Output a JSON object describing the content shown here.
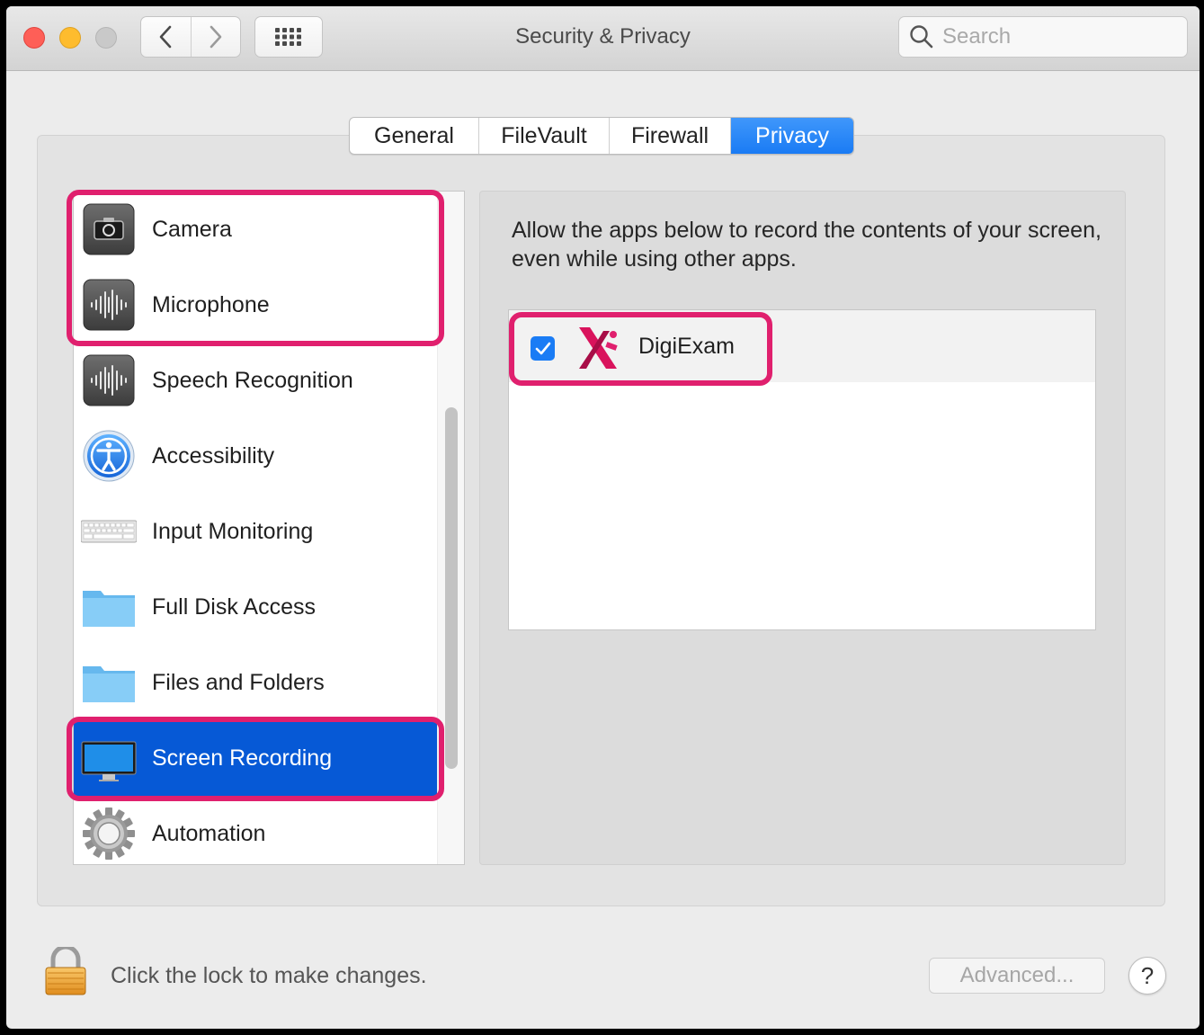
{
  "window": {
    "title": "Security & Privacy"
  },
  "toolbar": {
    "back_icon": "chevron-left-icon",
    "forward_icon": "chevron-right-icon",
    "grid_icon": "grid-icon",
    "search_placeholder": "Search"
  },
  "tabs": [
    {
      "label": "General",
      "active": false
    },
    {
      "label": "FileVault",
      "active": false
    },
    {
      "label": "Firewall",
      "active": false
    },
    {
      "label": "Privacy",
      "active": true
    }
  ],
  "sidebar": {
    "items": [
      {
        "label": "Camera",
        "icon": "camera-icon",
        "selected": false
      },
      {
        "label": "Microphone",
        "icon": "microphone-icon",
        "selected": false
      },
      {
        "label": "Speech Recognition",
        "icon": "speech-recognition-icon",
        "selected": false
      },
      {
        "label": "Accessibility",
        "icon": "accessibility-icon",
        "selected": false
      },
      {
        "label": "Input Monitoring",
        "icon": "keyboard-icon",
        "selected": false
      },
      {
        "label": "Full Disk Access",
        "icon": "folder-icon",
        "selected": false
      },
      {
        "label": "Files and Folders",
        "icon": "folder-icon",
        "selected": false
      },
      {
        "label": "Screen Recording",
        "icon": "display-icon",
        "selected": true
      },
      {
        "label": "Automation",
        "icon": "gear-icon",
        "selected": false
      }
    ]
  },
  "main": {
    "description": "Allow the apps below to record the contents of your screen, even while using other apps.",
    "apps": [
      {
        "name": "DigiExam",
        "checked": true,
        "icon": "digiexam-logo-icon"
      }
    ]
  },
  "footer": {
    "lock_text": "Click the lock to make changes.",
    "advanced_label": "Advanced...",
    "help_label": "?"
  },
  "colors": {
    "accent": "#1a7cf5",
    "selection": "#0659d6",
    "highlight": "#e0206e"
  }
}
